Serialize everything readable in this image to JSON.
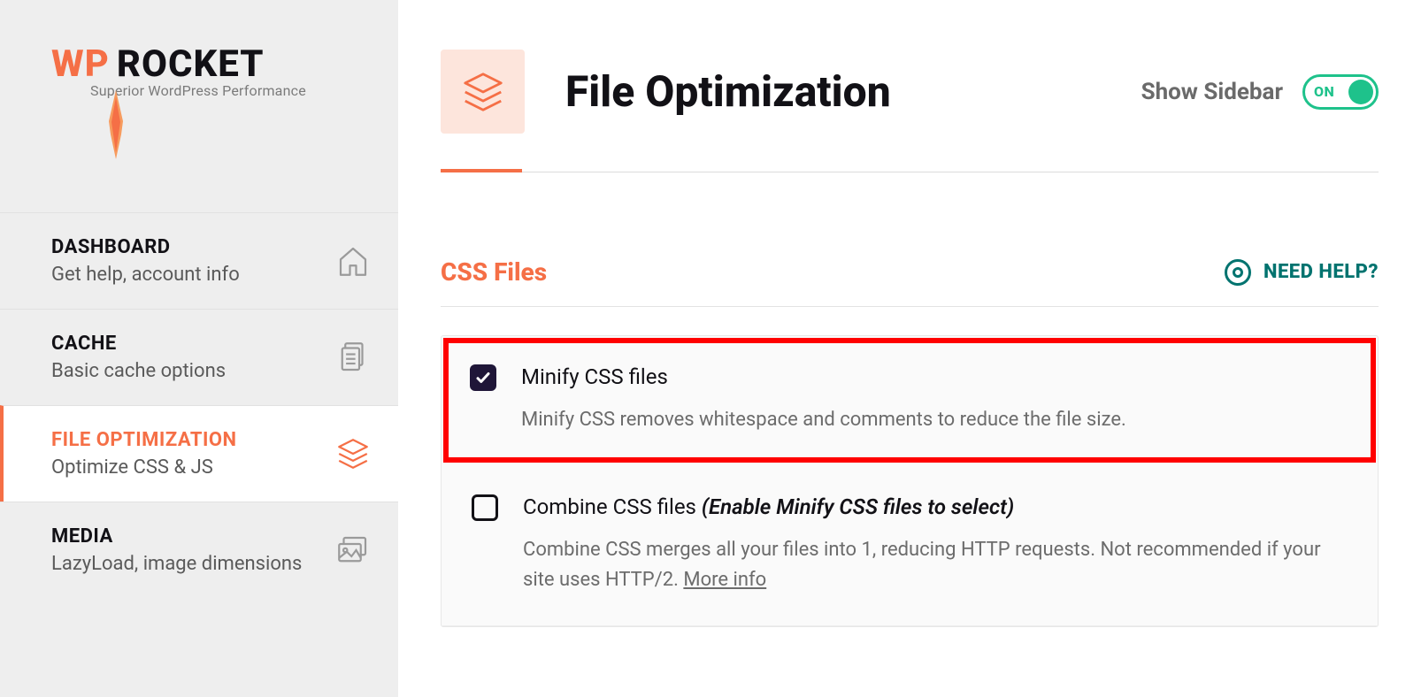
{
  "logo": {
    "wp": "WP",
    "rocket": "ROCKET",
    "sub": "Superior WordPress Performance"
  },
  "sidebar": {
    "items": [
      {
        "title": "DASHBOARD",
        "desc": "Get help, account info"
      },
      {
        "title": "CACHE",
        "desc": "Basic cache options"
      },
      {
        "title": "FILE OPTIMIZATION",
        "desc": "Optimize CSS & JS"
      },
      {
        "title": "MEDIA",
        "desc": "LazyLoad, image dimensions"
      }
    ]
  },
  "header": {
    "title": "File Optimization",
    "show_sidebar_label": "Show Sidebar",
    "toggle_on": "ON"
  },
  "section": {
    "title": "CSS Files",
    "need_help": "NEED HELP?"
  },
  "settings": {
    "minify": {
      "title": "Minify CSS files",
      "desc": "Minify CSS removes whitespace and comments to reduce the file size."
    },
    "combine": {
      "title": "Combine CSS files ",
      "hint": "(Enable Minify CSS files to select)",
      "desc_a": "Combine CSS merges all your files into 1, reducing HTTP requests. Not recommended if your site uses HTTP/2. ",
      "more_info": "More info"
    }
  }
}
